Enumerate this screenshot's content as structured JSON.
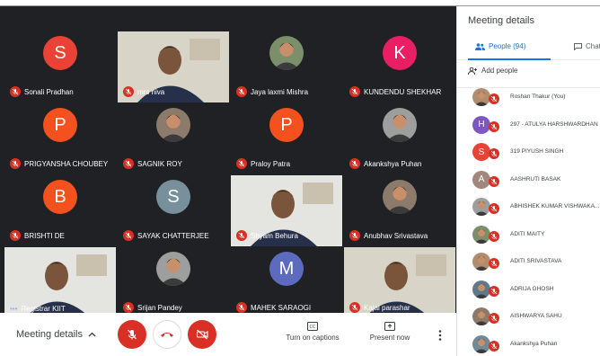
{
  "colors": {
    "stage_bg": "#202124",
    "danger": "#d93025",
    "accent": "#1a73e8"
  },
  "participants": [
    {
      "name": "Sonali Pradhan",
      "kind": "initial",
      "initial": "S",
      "color": "#ea4335"
    },
    {
      "name": "mrs niva",
      "kind": "video"
    },
    {
      "name": "Jaya laxmi Mishra",
      "kind": "photo"
    },
    {
      "name": "KUNDENDU SHEKHAR",
      "kind": "initial",
      "initial": "K",
      "color": "#e91e63"
    },
    {
      "name": "PRIGYANSHA CHOUBEY",
      "kind": "initial",
      "initial": "P",
      "color": "#f4511e"
    },
    {
      "name": "SAGNIK ROY",
      "kind": "photo"
    },
    {
      "name": "Praloy Patra",
      "kind": "initial",
      "initial": "P",
      "color": "#f4511e"
    },
    {
      "name": "Akankshya Puhan",
      "kind": "photo"
    },
    {
      "name": "BRISHTI DE",
      "kind": "initial",
      "initial": "B",
      "color": "#f4511e"
    },
    {
      "name": "SAYAK CHATTERJEE",
      "kind": "initial",
      "initial": "S",
      "color": "#78909c"
    },
    {
      "name": "Shyam Behura",
      "kind": "video"
    },
    {
      "name": "Anubhav Srivastava",
      "kind": "photo"
    },
    {
      "name": "Registrar KIIT",
      "kind": "video",
      "speaking": true
    },
    {
      "name": "Srijan Pandey",
      "kind": "photo"
    },
    {
      "name": "MAHEK SARAOGI",
      "kind": "initial",
      "initial": "M",
      "color": "#5c6bc0"
    },
    {
      "name": "Kajal parashar",
      "kind": "video"
    }
  ],
  "bottombar": {
    "meeting_details": "Meeting details",
    "captions_label": "Turn on captions",
    "present_label": "Present now"
  },
  "panel": {
    "title": "Meeting details",
    "tab_people": "People (94)",
    "tab_chat": "Chat",
    "add_people": "Add people",
    "people": [
      {
        "name": "Roshan Thakur (You)",
        "kind": "photo"
      },
      {
        "name": "297 - ATULYA HARSHWARDHAN",
        "kind": "initial",
        "initial": "H",
        "color": "#7e57c2"
      },
      {
        "name": "319 PIYUSH SINGH",
        "kind": "initial",
        "initial": "S",
        "color": "#ea4335"
      },
      {
        "name": "AASHRUTI BASAK",
        "kind": "initial",
        "initial": "A",
        "color": "#a1887f"
      },
      {
        "name": "ABHISHEK KUMAR VISHWAKA...",
        "kind": "photo"
      },
      {
        "name": "ADITI MAITY",
        "kind": "photo"
      },
      {
        "name": "ADITI SRIVASTAVA",
        "kind": "photo"
      },
      {
        "name": "ADRIJA GHOSH",
        "kind": "photo"
      },
      {
        "name": "AISHWARYA SAHU",
        "kind": "photo"
      },
      {
        "name": "Akankshya Puhan",
        "kind": "photo"
      }
    ]
  }
}
